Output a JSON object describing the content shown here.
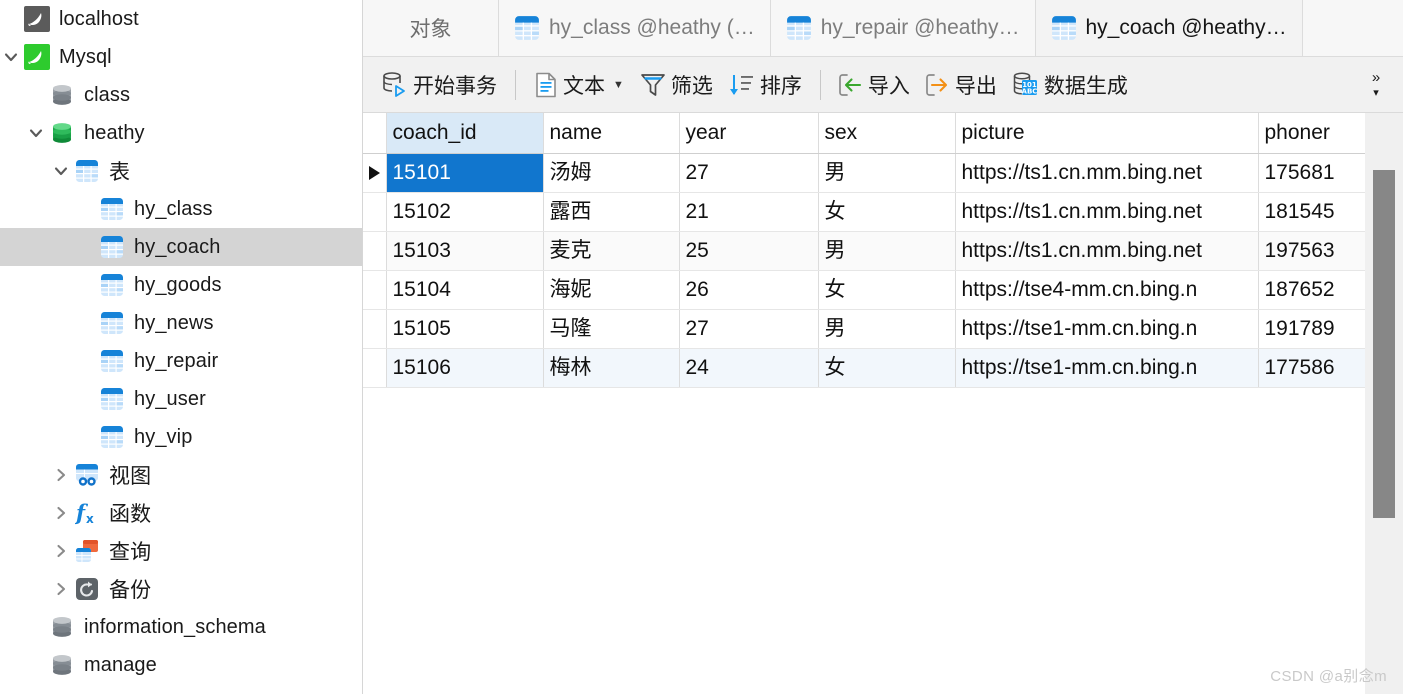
{
  "sidebar": {
    "items": [
      {
        "label": "localhost",
        "icon": "mysql-connection-gray-icon",
        "indent": 0,
        "twisty": "",
        "selected": false
      },
      {
        "label": "Mysql",
        "icon": "mysql-connection-green-icon",
        "indent": 0,
        "twisty": "down",
        "selected": false
      },
      {
        "label": "class",
        "icon": "database-gray-icon",
        "indent": 1,
        "twisty": "",
        "selected": false
      },
      {
        "label": "heathy",
        "icon": "database-green-icon",
        "indent": 1,
        "twisty": "down",
        "selected": false
      },
      {
        "label": "表",
        "icon": "table-folder-icon",
        "indent": 2,
        "twisty": "down",
        "selected": false
      },
      {
        "label": "hy_class",
        "icon": "table-icon",
        "indent": 3,
        "twisty": "",
        "selected": false
      },
      {
        "label": "hy_coach",
        "icon": "table-icon",
        "indent": 3,
        "twisty": "",
        "selected": true
      },
      {
        "label": "hy_goods",
        "icon": "table-icon",
        "indent": 3,
        "twisty": "",
        "selected": false
      },
      {
        "label": "hy_news",
        "icon": "table-icon",
        "indent": 3,
        "twisty": "",
        "selected": false
      },
      {
        "label": "hy_repair",
        "icon": "table-icon",
        "indent": 3,
        "twisty": "",
        "selected": false
      },
      {
        "label": "hy_user",
        "icon": "table-icon",
        "indent": 3,
        "twisty": "",
        "selected": false
      },
      {
        "label": "hy_vip",
        "icon": "table-icon",
        "indent": 3,
        "twisty": "",
        "selected": false
      },
      {
        "label": "视图",
        "icon": "view-icon",
        "indent": 2,
        "twisty": "right",
        "selected": false
      },
      {
        "label": "函数",
        "icon": "function-icon",
        "indent": 2,
        "twisty": "right",
        "selected": false
      },
      {
        "label": "查询",
        "icon": "query-icon",
        "indent": 2,
        "twisty": "right",
        "selected": false
      },
      {
        "label": "备份",
        "icon": "backup-icon",
        "indent": 2,
        "twisty": "right",
        "selected": false
      },
      {
        "label": "information_schema",
        "icon": "database-gray-icon",
        "indent": 1,
        "twisty": "",
        "selected": false
      },
      {
        "label": "manage",
        "icon": "database-gray-icon",
        "indent": 1,
        "twisty": "",
        "selected": false
      }
    ]
  },
  "tabs": [
    {
      "label": "对象",
      "icon": "none",
      "active": false,
      "kind": "object"
    },
    {
      "label": "hy_class @heathy (…",
      "icon": "table-icon",
      "active": false,
      "kind": "table"
    },
    {
      "label": "hy_repair @heathy…",
      "icon": "table-icon",
      "active": false,
      "kind": "table"
    },
    {
      "label": "hy_coach @heathy…",
      "icon": "table-icon",
      "active": true,
      "kind": "table"
    }
  ],
  "toolbar": {
    "items": [
      {
        "label": "开始事务",
        "icon": "begin-transaction-icon",
        "caret": false
      },
      {
        "sep": true
      },
      {
        "label": "文本",
        "icon": "text-icon",
        "caret": true
      },
      {
        "label": "筛选",
        "icon": "filter-icon",
        "caret": false
      },
      {
        "label": "排序",
        "icon": "sort-icon",
        "caret": false
      },
      {
        "sep": true
      },
      {
        "label": "导入",
        "icon": "import-icon",
        "caret": false
      },
      {
        "label": "导出",
        "icon": "export-icon",
        "caret": false
      },
      {
        "label": "数据生成",
        "icon": "data-generation-icon",
        "caret": false
      }
    ],
    "overflow_chevron": "»",
    "overflow_caret": "▾"
  },
  "grid": {
    "columns": [
      "coach_id",
      "name",
      "year",
      "sex",
      "picture",
      "phonenumber"
    ],
    "column_header_truncated": [
      "coach_id",
      "name",
      "year",
      "sex",
      "picture",
      "phoner"
    ],
    "key_column": "coach_id",
    "rows": [
      {
        "coach_id": "15101",
        "name": "汤姆",
        "year": "27",
        "sex": "男",
        "picture": "https://ts1.cn.mm.bing.net",
        "phonenumber": "175681"
      },
      {
        "coach_id": "15102",
        "name": "露西",
        "year": "21",
        "sex": "女",
        "picture": "https://ts1.cn.mm.bing.net",
        "phonenumber": "181545"
      },
      {
        "coach_id": "15103",
        "name": "麦克",
        "year": "25",
        "sex": "男",
        "picture": "https://ts1.cn.mm.bing.net",
        "phonenumber": "197563"
      },
      {
        "coach_id": "15104",
        "name": "海妮",
        "year": "26",
        "sex": "女",
        "picture": "https://tse4-mm.cn.bing.n",
        "phonenumber": "187652"
      },
      {
        "coach_id": "15105",
        "name": "马隆",
        "year": "27",
        "sex": "男",
        "picture": "https://tse1-mm.cn.bing.n",
        "phonenumber": "191789"
      },
      {
        "coach_id": "15106",
        "name": "梅林",
        "year": "24",
        "sex": "女",
        "picture": "https://tse1-mm.cn.bing.n",
        "phonenumber": "177586"
      }
    ],
    "selected_row_index": 0,
    "selected_column": "coach_id",
    "row_marker": "▶"
  },
  "watermark": "CSDN @a别念m",
  "colors": {
    "selection_blue": "#1176ce",
    "key_header_blue": "#d9e9f7",
    "sidebar_selection_gray": "#d4d4d4",
    "toolbar_bg": "#f1f1f1",
    "tabstrip_bg": "#f7f7f7",
    "scrollbar_thumb": "#878787",
    "table_icon_blue": "#1683d8",
    "database_green": "#14a54a",
    "watermark_gray": "#c9c9c9"
  }
}
